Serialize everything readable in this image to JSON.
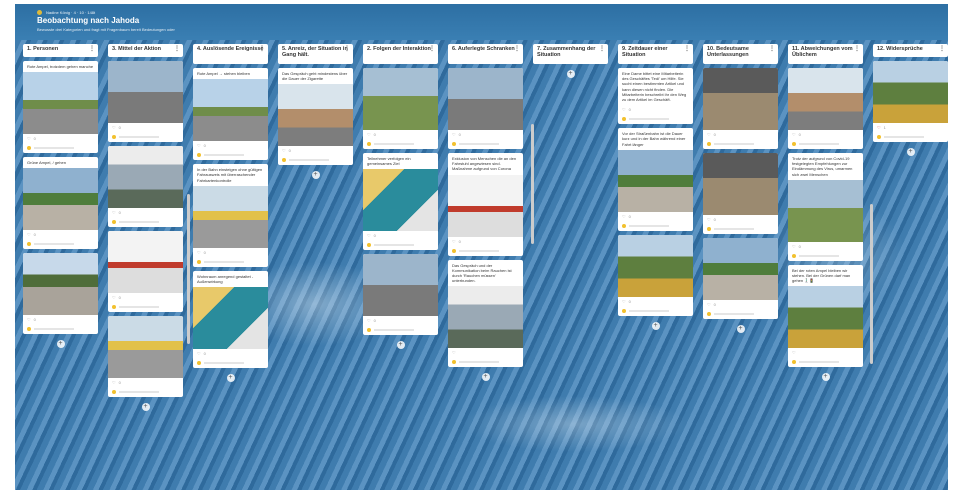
{
  "board": {
    "meta": "Nadine König · 4 · 10 · 148t",
    "title": "Beobachtung nach Jahoda",
    "subtitle": "Bewusste drei Kategorien und fragt mit Fragenbaum bereit Bedeutungen oder"
  },
  "columns": [
    {
      "title": "1. Personen",
      "cards": [
        {
          "text": "Rote Ampel, trotzdem gehen manche",
          "img": "i1",
          "count": "0"
        },
        {
          "text": "Grüne Ampel, / gehen",
          "img": "i8",
          "count": "0"
        },
        {
          "text": "",
          "img": "i3",
          "count": "0"
        }
      ]
    },
    {
      "title": "3. Mittel der Aktion",
      "cards": [
        {
          "text": "",
          "img": "i6",
          "count": "0"
        },
        {
          "text": "",
          "img": "i4",
          "count": "0"
        },
        {
          "text": "",
          "img": "i7",
          "count": "0"
        },
        {
          "text": "",
          "img": "i10",
          "count": "0"
        }
      ]
    },
    {
      "title": "4. Auslösende Ereignisse",
      "cards": [
        {
          "text": "Rote Ampel → stehen bleiben",
          "img": "i1",
          "count": "0"
        },
        {
          "text": "In der Bahn einsteigen ohne gültigen Fahrausweis mit überraschender Fahrkartenkontrolle",
          "img": "i10",
          "count": "0"
        },
        {
          "text": "Wohnraum anregend gestaltet - Außenwirkung",
          "img": "i5",
          "count": "0"
        }
      ]
    },
    {
      "title": "5. Anreiz, der Situation in Gang hält.",
      "cards": [
        {
          "text": "Das Gespräch geht mindestens über die Dauer der Zigarette",
          "img": "i2",
          "count": "0"
        }
      ]
    },
    {
      "title": "2. Folgen der Interaktion",
      "cards": [
        {
          "text": "",
          "img": "i11",
          "count": "0"
        },
        {
          "text": "Teilnehmer verfolgen ein gemeinsames Ziel",
          "img": "i5",
          "count": "0"
        },
        {
          "text": "",
          "img": "i6",
          "count": "0"
        }
      ]
    },
    {
      "title": "6. Auferlegte Schranken",
      "cards": [
        {
          "text": "",
          "img": "i6",
          "count": "0"
        },
        {
          "text": "Exklusion von Menschen die an den Fahrstuhl angewiesen sind. Maßnahme aufgrund von Corona",
          "img": "i7",
          "count": "0"
        },
        {
          "text": "Das Gespräch und der Kommunikation beim Rauchen ist durch 'Rauchen müssen' unterbunden.",
          "img": "i4",
          "count": ""
        }
      ]
    },
    {
      "title": "7. Zusammenhang der Situation",
      "cards": []
    },
    {
      "title": "9. Zeitdauer einer Situation",
      "cards": [
        {
          "text": "Eine Dame bittet eine Mitarbeiterin des Geschäftes 'Tedi' um Hilfe. Sie sucht einen bestimmten Artikel und kann diesen nicht finden. Die Mitarbeiterin beschreibt ihr den Weg zu dem Artikel im Geschäft.",
          "img": "",
          "count": "0"
        },
        {
          "text": "Vor der Straßenbahn ist die Dauer kurz und in der Bahn während einer Fahrt länger",
          "img": "i8",
          "count": "0"
        },
        {
          "text": "",
          "img": "i12",
          "count": "0"
        }
      ]
    },
    {
      "title": "10. Bedeutsame Unterlassungen",
      "cards": [
        {
          "text": "",
          "img": "i9",
          "count": "0"
        },
        {
          "text": "",
          "img": "i9",
          "count": "0"
        },
        {
          "text": "",
          "img": "i8",
          "count": "0"
        }
      ]
    },
    {
      "title": "11. Abweichungen vom Üblichem",
      "cards": [
        {
          "text": "",
          "img": "i2",
          "count": "0"
        },
        {
          "text": "Trotz der aufgrund von Covid-19 festgelegten Empfehlungen zur Eindämmung des Virus, umarmen sich zwei Menschen",
          "img": "i11",
          "count": "0"
        },
        {
          "text": "Bei der roten Ampel bleiben wir stehen. Bei der Grünen darf man gehen 🚶🏻‍♂️🚦",
          "img": "i12",
          "count": ""
        }
      ]
    },
    {
      "title": "12. Widersprüche",
      "cards": [
        {
          "text": "",
          "img": "i12",
          "count": "1"
        }
      ]
    }
  ],
  "ui": {
    "add_label": "+",
    "menu_label": "⋮",
    "heart_icon": "heart-icon",
    "menu_icon": "menu-icon"
  }
}
